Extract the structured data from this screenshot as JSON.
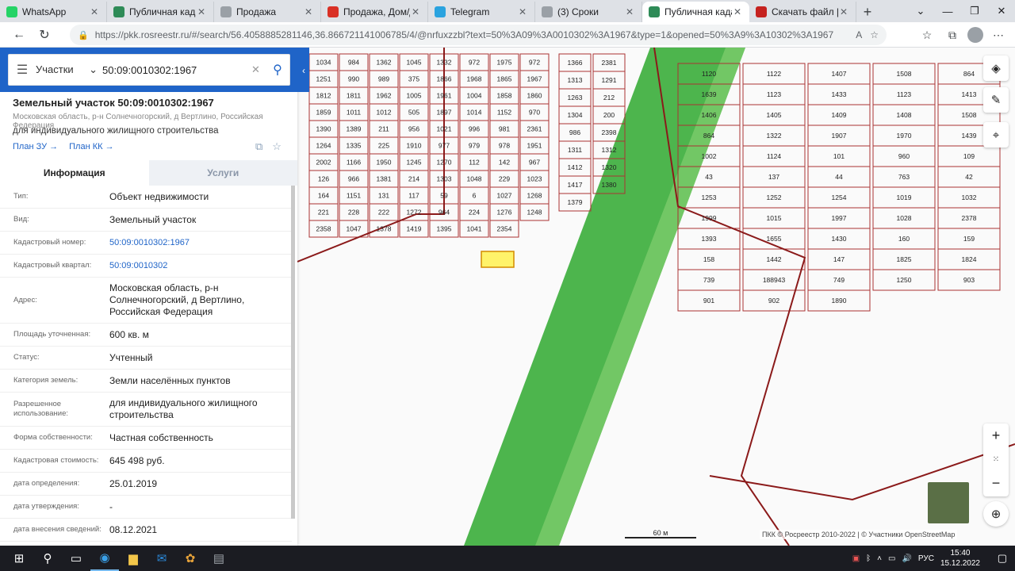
{
  "tabs": [
    {
      "title": "WhatsApp",
      "color": "#25d366",
      "active": false
    },
    {
      "title": "Публичная кадас",
      "color": "#2e8b57",
      "active": false
    },
    {
      "title": "Продажа",
      "color": "#9aa0a6",
      "active": false
    },
    {
      "title": "Продажа, Дом/да",
      "color": "#d93025",
      "active": false
    },
    {
      "title": "Telegram",
      "color": "#2aa3df",
      "active": false
    },
    {
      "title": "(3) Сроки",
      "color": "#9aa0a6",
      "active": false
    },
    {
      "title": "Публичная кадас",
      "color": "#2e8b57",
      "active": true
    },
    {
      "title": "Скачать файл | iL",
      "color": "#c5221f",
      "active": false
    }
  ],
  "address": {
    "url": "https://pkk.rosreestr.ru/#/search/56.4058885281146,36.866721141006785/4/@nrfuxzzbl?text=50%3A09%3A0010302%3A1967&type=1&opened=50%3A9%3A10302%3A1967"
  },
  "search": {
    "category": "Участки",
    "value": "50:09:0010302:1967"
  },
  "parcel": {
    "title": "Земельный участок 50:09:0010302:1967",
    "address_short": "Московская область, р-н Солнечногорский, д Вертлино, Российская Федерация",
    "purpose": "для индивидуального жилищного строительства",
    "link_plan_zu": "План ЗУ →",
    "link_plan_kk": "План КК →"
  },
  "info_tabs": [
    "Информация",
    "Услуги"
  ],
  "rows": [
    {
      "label": "Тип:",
      "value": "Объект недвижимости",
      "link": false
    },
    {
      "label": "Вид:",
      "value": "Земельный участок",
      "link": false
    },
    {
      "label": "Кадастровый номер:",
      "value": "50:09:0010302:1967",
      "link": true
    },
    {
      "label": "Кадастровый квартал:",
      "value": "50:09:0010302",
      "link": true
    },
    {
      "label": "Адрес:",
      "value": "Московская область, р-н Солнечногорский, д Вертлино, Российская Федерация",
      "link": false
    },
    {
      "label": "Площадь уточненная:",
      "value": "600 кв. м",
      "link": false
    },
    {
      "label": "Статус:",
      "value": "Учтенный",
      "link": false
    },
    {
      "label": "Категория земель:",
      "value": "Земли населённых пунктов",
      "link": false
    },
    {
      "label": "Разрешенное использование:",
      "value": "для индивидуального жилищного строительства",
      "link": false
    },
    {
      "label": "Форма собственности:",
      "value": "Частная собственность",
      "link": false
    },
    {
      "label": "Кадастровая стоимость:",
      "value": "645 498 руб.",
      "link": false
    },
    {
      "label": "дата определения:",
      "value": "25.01.2019",
      "link": false
    },
    {
      "label": "дата утверждения:",
      "value": "-",
      "link": false
    },
    {
      "label": "дата внесения сведений:",
      "value": "08.12.2021",
      "link": false
    }
  ],
  "map": {
    "scale_label": "60 м",
    "copyright": "ПКК © Росреестр 2010-2022 | © Участники OpenStreetMap",
    "selected_parcel": "1967",
    "parcels_left": [
      "1034",
      "984",
      "1362",
      "1045",
      "1332",
      "972",
      "1975",
      "972",
      "1251",
      "990",
      "989",
      "375",
      "1866",
      "1968",
      "1865",
      "1967",
      "1812",
      "1811",
      "1962",
      "1005",
      "1961",
      "1004",
      "1858",
      "1860",
      "1859",
      "1011",
      "1012",
      "505",
      "1897",
      "1014",
      "1152",
      "970",
      "1390",
      "1389",
      "211",
      "956",
      "1021",
      "996",
      "981",
      "2361",
      "1264",
      "1335",
      "225",
      "1910",
      "977",
      "979",
      "978",
      "1951",
      "2002",
      "1166",
      "1950",
      "1245",
      "1270",
      "112",
      "142",
      "967",
      "126",
      "966",
      "1381",
      "214",
      "1303",
      "1048",
      "229",
      "1023",
      "164",
      "1151",
      "131",
      "117",
      "59",
      "6",
      "1027",
      "1268",
      "221",
      "228",
      "222",
      "1272",
      "964",
      "224",
      "1276",
      "1248",
      "2358",
      "1047",
      "1378",
      "1419",
      "1395",
      "1041",
      "2354"
    ],
    "parcels_mid": [
      "1366",
      "2381",
      "1313",
      "1291",
      "1263",
      "212",
      "1304",
      "200",
      "986",
      "2398",
      "1311",
      "1312",
      "1412",
      "1320",
      "1417",
      "1380",
      "1379"
    ],
    "parcels_right": [
      "1120",
      "1122",
      "1407",
      "1508",
      "864",
      "1639",
      "1123",
      "1433",
      "1123",
      "1413",
      "1406",
      "1405",
      "1409",
      "1408",
      "1508",
      "864",
      "1322",
      "1907",
      "1970",
      "1439",
      "1002",
      "1124",
      "101",
      "960",
      "109",
      "43",
      "137",
      "44",
      "763",
      "42",
      "1253",
      "1252",
      "1254",
      "1019",
      "1032",
      "1999",
      "1015",
      "1997",
      "1028",
      "2378",
      "1393",
      "1655",
      "1430",
      "160",
      "159",
      "158",
      "1442",
      "147",
      "1825",
      "1824",
      "739",
      "188943",
      "749",
      "1250",
      "903",
      "901",
      "902",
      "1890"
    ]
  },
  "taskbar": {
    "lang": "РУС",
    "time": "15:40",
    "date": "15.12.2022"
  }
}
